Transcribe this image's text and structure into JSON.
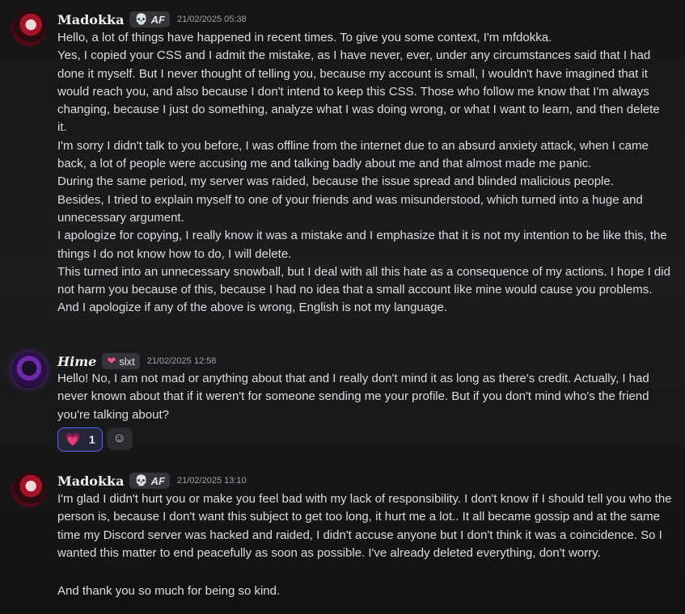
{
  "messages": [
    {
      "username": "Madokka",
      "tag_icon": "skull-icon",
      "tag_text": "AF",
      "timestamp": "21/02/2025 05:38",
      "lines": [
        "Hello, a lot of things have happened in recent times. To give you some context, I'm mfdokka.",
        "Yes, I copied your CSS and I admit the mistake, as I have never, ever, under any circumstances said that I had done it myself. But I never thought of telling you, because my account is small, I wouldn't have imagined that it would reach you, and also because I don't intend to keep this CSS. Those who follow me know that I'm always changing, because I just do something, analyze what I was doing wrong, or what I want to learn, and then delete it.",
        "I'm sorry I didn't talk to you before, I was offline from the internet due to an absurd anxiety attack, when I came back, a lot of people were accusing me and talking badly about me and that almost made me panic.",
        "During the same period, my server was raided, because the issue spread and blinded malicious people.",
        "Besides, I tried to explain myself to one of your friends and was misunderstood, which turned into a huge and unnecessary argument.",
        "I apologize for copying, I really know it was a mistake and I emphasize that it is not my intention to be like this, the things I do not know how to do, I will delete.",
        "This turned into an unnecessary snowball, but I deal with all this hate as a consequence of my actions. I hope I did not harm you because of this, because I had no idea that a small account like mine would cause you problems.",
        "And I apologize if any of the above is wrong, English is not my language."
      ]
    },
    {
      "username": "Hime",
      "tag_icon": "heart-icon",
      "tag_text": "slxt",
      "timestamp": "21/02/2025 12:58",
      "lines": [
        "Hello! No, I am not mad or anything about that and I really don't mind it as long as there's credit. Actually, I had never known about that if it weren't for someone sending me your profile. But if you don't mind who's the friend you're talking about?"
      ],
      "reaction": {
        "icon": "sparkle-heart-icon",
        "count": "1"
      }
    },
    {
      "username": "Madokka",
      "tag_icon": "skull-icon",
      "tag_text": "AF",
      "timestamp": "21/02/2025 13:10",
      "lines": [
        "I'm glad I didn't hurt you or make you feel bad with my lack of responsibility. I don't know if I should tell you who the person is, because I don't want this subject to get too long, it hurt me a lot.. It all became gossip and at the same time my Discord server was hacked and raided, I didn't accuse anyone but I don't think it was a coincidence.  So I wanted this matter to end peacefully as soon as possible. I've already deleted everything, don't worry."
      ],
      "followup": "And thank you so much for being so kind."
    }
  ]
}
